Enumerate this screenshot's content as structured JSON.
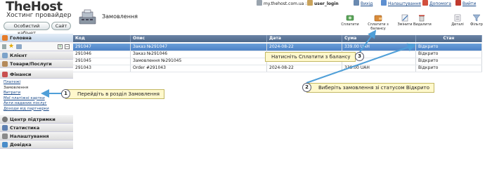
{
  "brand": {
    "title": "TheHost",
    "subtitle": "Хостинг провайдер"
  },
  "header_buttons": {
    "cabinet": "Особистий кабінет",
    "site": "Сайт"
  },
  "page": {
    "title": "Замовлення"
  },
  "topbar": {
    "domain": "my.thehost.com.ua ::",
    "user": "user_login",
    "links": [
      "Вихід",
      "Налаштування",
      "Допомога",
      "Вийти"
    ]
  },
  "toolbar": [
    "Сплатити",
    "Сплатити з балансу",
    "Змінити",
    "Видалити",
    "Деталі",
    "Фільтр"
  ],
  "sidebar": {
    "sections": [
      {
        "label": "Головна",
        "state": "active"
      },
      {
        "label": "Клієнт",
        "state": "normal"
      },
      {
        "label": "Товари/Послуги",
        "state": "normal"
      },
      {
        "label": "Фінанси",
        "state": "open"
      },
      {
        "label": "Центр підтримки",
        "state": "normal"
      },
      {
        "label": "Статистика",
        "state": "normal"
      },
      {
        "label": "Налаштування",
        "state": "normal"
      },
      {
        "label": "Довідка",
        "state": "normal"
      }
    ],
    "finance_items": [
      "Платежі",
      "Замовлення",
      "Витрати",
      "Мої платіжні картки",
      "Акти наданих послуг",
      "Доходи від партнерки"
    ],
    "current_finance_item": "Замовлення"
  },
  "table": {
    "columns": [
      "Код",
      "Опис",
      "Дата",
      "Сума",
      "Стан"
    ],
    "rows": [
      [
        "291047",
        "Заказ №291047",
        "2024-08-22",
        "339.00 UAH",
        "Відкрито"
      ],
      [
        "291046",
        "Заказ №291046",
        "",
        "",
        "Відкрито"
      ],
      [
        "291045",
        "Замовлення №291045",
        "",
        "",
        "Відкрито"
      ],
      [
        "291043",
        "Order #291043",
        "2024-08-22",
        "339.00 UAH",
        "Відкрито"
      ]
    ],
    "selected_row": 0
  },
  "callouts": [
    {
      "num": "1",
      "text": "Перейдіть в розділ Замовлення"
    },
    {
      "num": "2",
      "text": "Виберіть замовлення зі статусом Відкрито"
    },
    {
      "num": "3",
      "text": "Натисніть Сплатити з балансу"
    }
  ],
  "colors": {
    "accent": "#4c82c6",
    "header": "#5a7499",
    "callout_bg": "#fff8cc",
    "arrow": "#4f9fd8"
  }
}
